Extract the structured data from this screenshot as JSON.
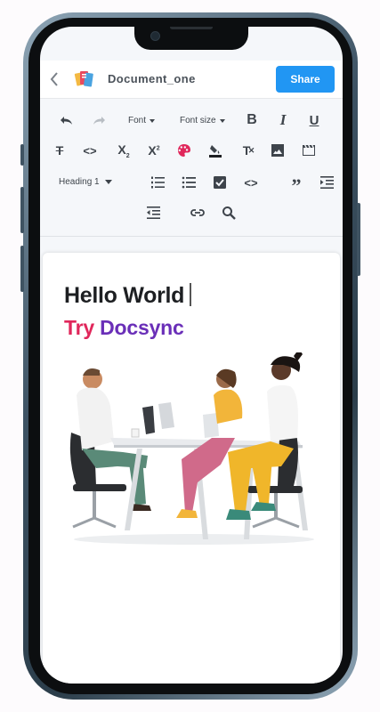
{
  "header": {
    "back_icon": "chevron-left-icon",
    "logo_icon": "document-stack-logo",
    "document_title": "Document_one",
    "share_label": "Share"
  },
  "toolbar": {
    "font_label": "Font",
    "font_size_label": "Font size",
    "heading_label": "Heading 1",
    "icons": [
      "undo-icon",
      "redo-icon",
      "bold-icon",
      "italic-icon",
      "underline-icon",
      "strikethrough-icon",
      "code-icon",
      "subscript-icon",
      "superscript-icon",
      "text-color-icon",
      "highlight-icon",
      "clear-format-icon",
      "image-icon",
      "video-icon",
      "ordered-list-icon",
      "bullet-list-icon",
      "checklist-icon",
      "code-block-icon",
      "quote-icon",
      "indent-icon",
      "outdent-icon",
      "link-icon",
      "search-icon"
    ]
  },
  "document": {
    "heading": "Hello World",
    "subheading_part1": "Try",
    "subheading_part2": "Docsync",
    "image": "team-meeting-illustration"
  },
  "colors": {
    "accent": "#2196f3",
    "try_color": "#e0275b",
    "docsync_color": "#6a2fb8",
    "palette_icon": "#e0275b"
  }
}
